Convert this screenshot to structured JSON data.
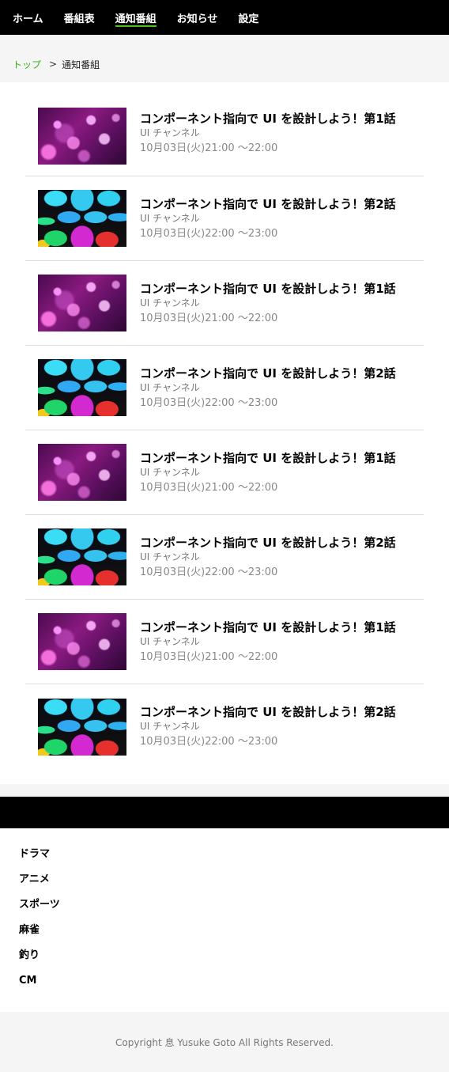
{
  "nav": {
    "items": [
      {
        "label": "ホーム",
        "active": false
      },
      {
        "label": "番組表",
        "active": false
      },
      {
        "label": "通知番組",
        "active": true
      },
      {
        "label": "お知らせ",
        "active": false
      },
      {
        "label": "設定",
        "active": false
      }
    ],
    "accent_color": "#4cc119"
  },
  "breadcrumb": {
    "home": "トップ",
    "separator": ">",
    "current": "通知番組"
  },
  "programs": [
    {
      "thumbnail": "bokeh-purple",
      "title": "コンポーネント指向で UI を設計しよう！第1話",
      "channel": "UI チャンネル",
      "time": "10月03日(火)21:00 〜22:00"
    },
    {
      "thumbnail": "hexagon-tiles",
      "title": "コンポーネント指向で UI を設計しよう！第2話",
      "channel": "UI チャンネル",
      "time": "10月03日(火)22:00 〜23:00"
    },
    {
      "thumbnail": "bokeh-purple",
      "title": "コンポーネント指向で UI を設計しよう！第1話",
      "channel": "UI チャンネル",
      "time": "10月03日(火)21:00 〜22:00"
    },
    {
      "thumbnail": "hexagon-tiles",
      "title": "コンポーネント指向で UI を設計しよう！第2話",
      "channel": "UI チャンネル",
      "time": "10月03日(火)22:00 〜23:00"
    },
    {
      "thumbnail": "bokeh-purple",
      "title": "コンポーネント指向で UI を設計しよう！第1話",
      "channel": "UI チャンネル",
      "time": "10月03日(火)21:00 〜22:00"
    },
    {
      "thumbnail": "hexagon-tiles",
      "title": "コンポーネント指向で UI を設計しよう！第2話",
      "channel": "UI チャンネル",
      "time": "10月03日(火)22:00 〜23:00"
    },
    {
      "thumbnail": "bokeh-purple",
      "title": "コンポーネント指向で UI を設計しよう！第1話",
      "channel": "UI チャンネル",
      "time": "10月03日(火)21:00 〜22:00"
    },
    {
      "thumbnail": "hexagon-tiles",
      "title": "コンポーネント指向で UI を設計しよう！第2話",
      "channel": "UI チャンネル",
      "time": "10月03日(火)22:00 〜23:00"
    }
  ],
  "genres": [
    "ドラマ",
    "アニメ",
    "スポーツ",
    "麻雀",
    "釣り",
    "CM"
  ],
  "footer": {
    "copyright": "Copyright 息 Yusuke Goto All Rights Reserved."
  }
}
